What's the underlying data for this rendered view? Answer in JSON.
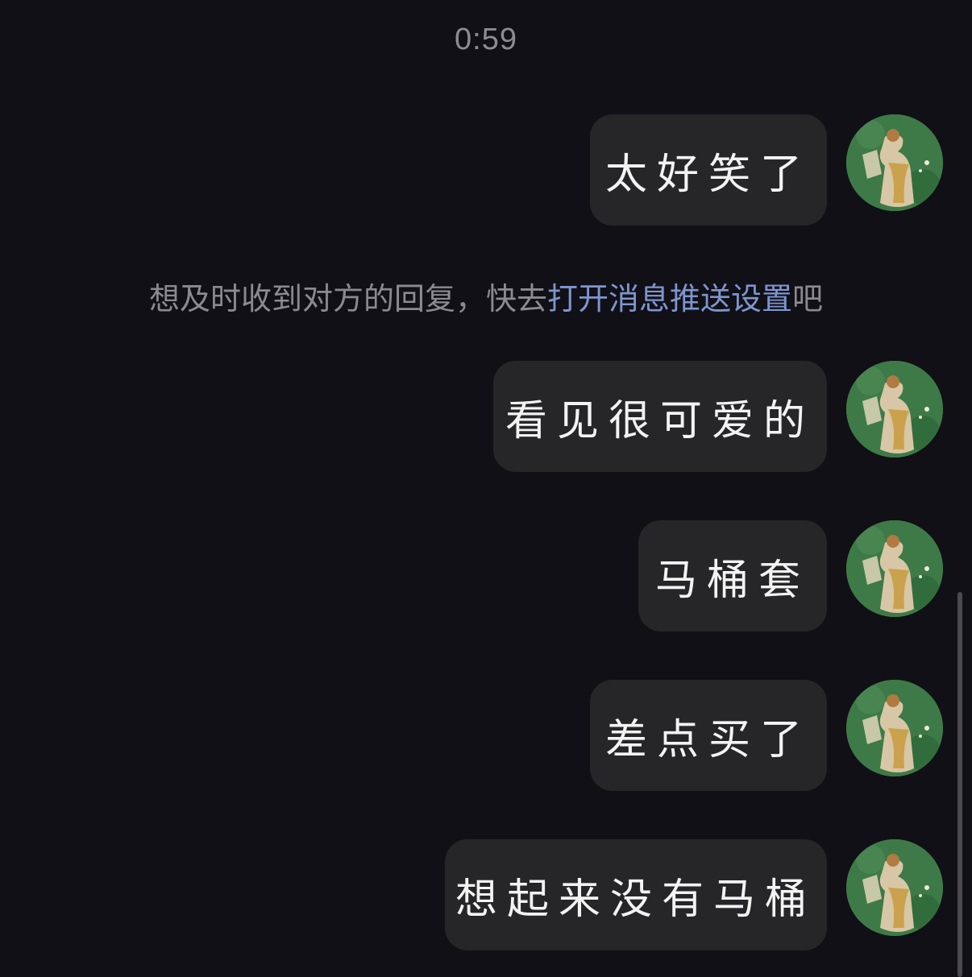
{
  "timestamp": "0:59",
  "system_notice": {
    "prefix": "想及时收到对方的回复，快去",
    "link": "打开消息推送设置",
    "suffix": "吧"
  },
  "messages": [
    {
      "text": "太好笑了",
      "sender": "self"
    },
    {
      "text": "看见很可爱的",
      "sender": "self"
    },
    {
      "text": "马桶套",
      "sender": "self"
    },
    {
      "text": "差点买了",
      "sender": "self"
    },
    {
      "text": "想起来没有马桶",
      "sender": "self"
    }
  ],
  "colors": {
    "background": "#111016",
    "bubble": "#262628",
    "link": "#7e96cf",
    "muted_text": "#8b8a91"
  },
  "icons": {
    "avatar": "avatar-fresco-icon"
  }
}
